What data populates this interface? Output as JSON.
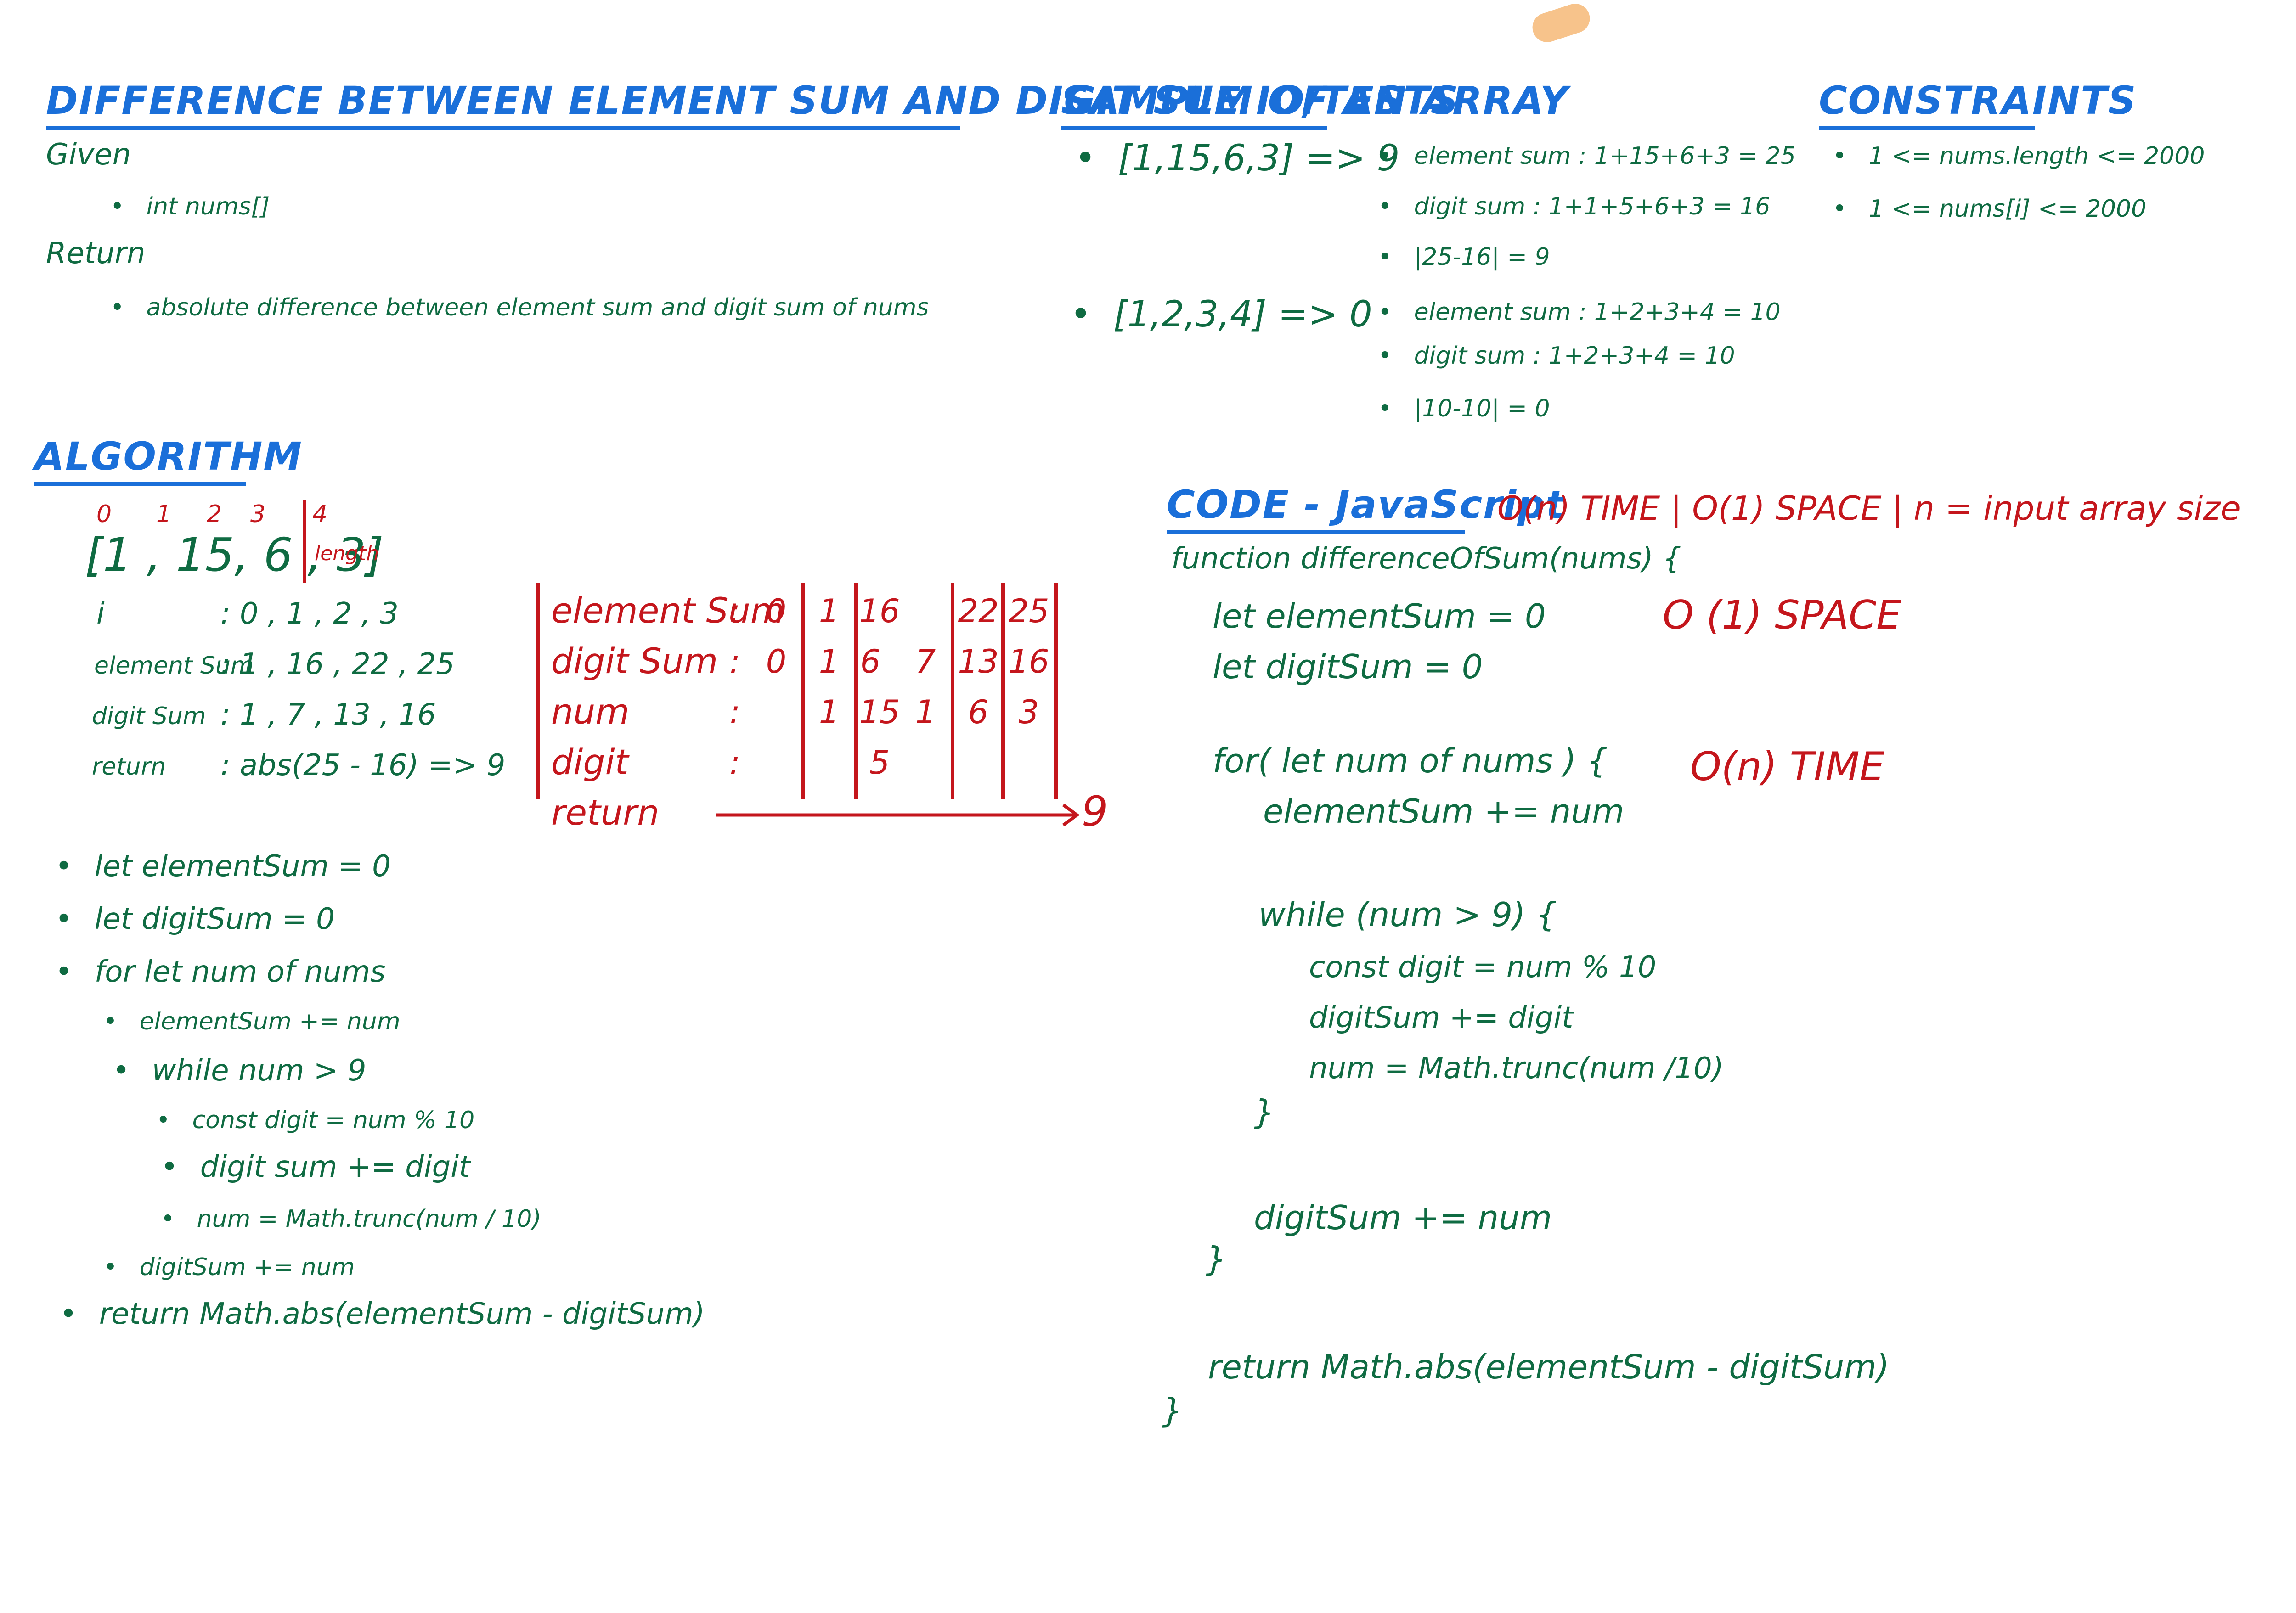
{
  "title": "DIFFERENCE BETWEEN ELEMENT SUM AND DIGIT SUM OF AN ARRAY",
  "given": {
    "label": "Given",
    "item": "int nums[]"
  },
  "return_section": {
    "label": "Return",
    "item": "absolute difference between element sum and digit sum of nums"
  },
  "sample": {
    "heading": "SAMPLE IO/TESTS",
    "test1": "[1,15,6,3] => 9",
    "test1_steps": [
      "element sum : 1+15+6+3 = 25",
      "digit sum : 1+1+5+6+3 = 16",
      "|25-16| = 9"
    ],
    "test2": "[1,2,3,4] => 0",
    "test2_steps": [
      "element sum : 1+2+3+4 = 10",
      "digit sum : 1+2+3+4 = 10",
      "|10-10| = 0"
    ]
  },
  "constraints": {
    "heading": "CONSTRAINTS",
    "items": [
      "1 <= nums.length <= 2000",
      "1 <= nums[i] <= 2000"
    ]
  },
  "algorithm": {
    "heading": "ALGORITHM",
    "indices": [
      "0",
      "1",
      "2",
      "3",
      "4"
    ],
    "array": "[1 , 15, 6 , 3]",
    "length_label": "length",
    "trace": {
      "i_label": "i",
      "i_values": ": 0 , 1 , 2 , 3",
      "element_label": "element Sum",
      "element_values": ": 1 , 16 , 22 , 25",
      "digit_label": "digit Sum",
      "digit_values": ": 1 , 7 , 13 , 16",
      "return_label": "return",
      "return_values": ": abs(25 - 16) => 9"
    },
    "table": {
      "rows": [
        "element Sum",
        "digit Sum",
        "num",
        "digit",
        "return"
      ],
      "element_sum": [
        "0",
        "1",
        "16",
        "22",
        "25"
      ],
      "digit_sum": [
        "0",
        "1",
        "6",
        "7",
        "13",
        "16"
      ],
      "num": [
        "1",
        "15",
        "1",
        "6",
        "3"
      ],
      "digit": [
        "5"
      ],
      "return_value": "9"
    },
    "steps": [
      "let elementSum = 0",
      "let digitSum = 0",
      "for let num of nums",
      "elementSum += num",
      "while num > 9",
      "const digit = num % 10",
      "digit sum += digit",
      "num = Math.trunc(num / 10)",
      "digitSum += num",
      "return Math.abs(elementSum - digitSum)"
    ]
  },
  "code": {
    "heading": "CODE - JavaScript",
    "complexity": "O(n) TIME | O(1) SPACE | n = input array size",
    "space_note": "O (1) SPACE",
    "time_note": "O(n) TIME",
    "lines": [
      "function differenceOfSum(nums) {",
      "let elementSum = 0",
      "let digitSum = 0",
      "for( let num of nums ) {",
      "elementSum += num",
      "while (num > 9) {",
      "const digit = num % 10",
      "digitSum += digit",
      "num = Math.trunc(num /10)",
      "}",
      "digitSum += num",
      "}",
      "return Math.abs(elementSum - digitSum)",
      "}"
    ]
  },
  "colors": {
    "heading_blue": "#1a6fd9",
    "ink_green": "#0f6b42",
    "ink_red": "#c4161c",
    "blob_orange": "#f7c38b"
  }
}
